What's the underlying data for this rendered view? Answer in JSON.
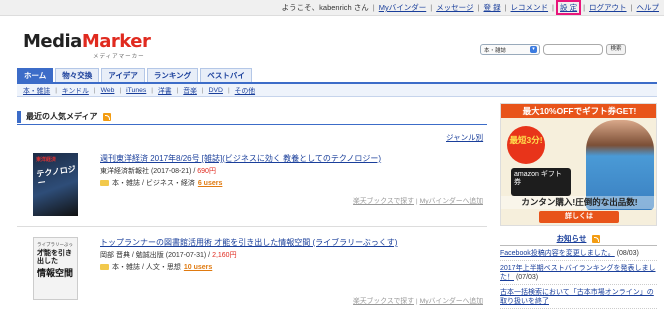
{
  "topbar": {
    "greeting": "ようこそ、kabenrich さん",
    "links": [
      "Myバインダー",
      "メッセージ",
      "登 録",
      "レコメンド",
      "設 定",
      "ログアウト",
      "ヘルプ"
    ]
  },
  "logo": {
    "main_a": "Media",
    "main_b": "Marker",
    "sub": "メディアマーカー"
  },
  "search": {
    "select_value": "本・雑誌",
    "button": "検索"
  },
  "tabs": [
    "ホーム",
    "物々交換",
    "アイデア",
    "ランキング",
    "ベストバイ"
  ],
  "subnav": [
    "本・雑誌",
    "キンドル",
    "Web",
    "iTunes",
    "洋書",
    "音楽",
    "DVD",
    "その他"
  ],
  "section": {
    "title": "最近の人気メディア",
    "genre_link": "ジャンル別"
  },
  "items": [
    {
      "title": "週刊東洋経済 2017年8/26号 [雑誌](ビジネスに効く 教養としてのテクノロジー)",
      "publisher": "東洋経済新報社",
      "date": "(2017-08-21)",
      "price": "690円",
      "category": "本・雑誌 / ビジネス・経済",
      "users": "6 users",
      "action1": "楽天ブックスで探す",
      "action2": "Myバインダーへ追加",
      "cover_text_top": "東洋経済",
      "cover_text_big": "テクノロジー"
    },
    {
      "title": "トップランナーの図書館活用術 才能を引き出した情報空間 (ライブラリーぶっくす)",
      "publisher": "岡部 晋典",
      "publisher2": "勉誠出版",
      "date": "(2017-07-31)",
      "price": "2,160円",
      "category": "本・雑誌 / 人文・思想",
      "users": "10 users",
      "action1": "楽天ブックスで探す",
      "action2": "Myバインダーへ追加",
      "cover_l1": "ライブラリーぶっくす",
      "cover_l2": "才能を引き出した",
      "cover_l3": "情報空間"
    }
  ],
  "ad": {
    "head": "最大10%OFFでギフト券GET!",
    "burst": "最短3分!",
    "card": "amazon ギフト券",
    "cta1": "カンタン購入!圧倒的な出品数!",
    "cta2": "詳しくは"
  },
  "news": {
    "title": "お知らせ",
    "items": [
      {
        "text": "Facebook投稿内容を変更しました。",
        "date": "(08/03)"
      },
      {
        "text": "2017年上半期ベストバイランキングを発表しました！",
        "date": "(07/03)"
      },
      {
        "text": "古本一括検索において「古本市場オンライン」の取り扱いを終了",
        "date": ""
      }
    ]
  }
}
